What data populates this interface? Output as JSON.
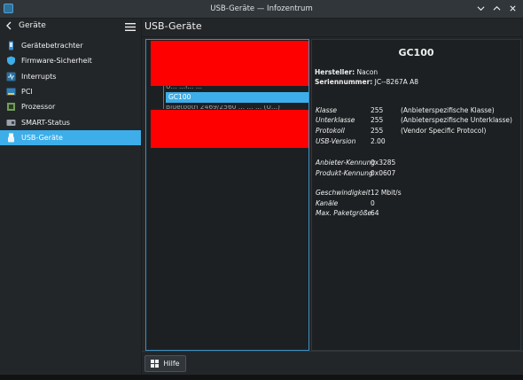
{
  "window": {
    "title": "USB-Geräte — Infozentrum",
    "icons": [
      "app-icon",
      "chevron-down-icon",
      "chevron-up-icon",
      "close-icon"
    ]
  },
  "sidebar": {
    "back_label": "Geräte",
    "items": [
      {
        "label": "Gerätebetrachter",
        "icon": "device-viewer-icon"
      },
      {
        "label": "Firmware-Sicherheit",
        "icon": "shield-icon"
      },
      {
        "label": "Interrupts",
        "icon": "interrupts-icon"
      },
      {
        "label": "PCI",
        "icon": "pci-icon"
      },
      {
        "label": "Prozessor",
        "icon": "processor-icon"
      },
      {
        "label": "SMART-Status",
        "icon": "smart-status-icon"
      },
      {
        "label": "USB-Geräte",
        "icon": "usb-icon",
        "active": true
      }
    ]
  },
  "main": {
    "title": "USB-Geräte",
    "tree": {
      "cut_label": "U...  ...l... ...",
      "selected": "GC100",
      "below_label": "Bluetooth 2469/2560 ... ... ... (U...)"
    },
    "detail": {
      "title": "GC100",
      "manufacturer_key": "Hersteller:",
      "manufacturer_value": "Nacon",
      "serial_key": "Seriennummer:",
      "serial_value": "JC--8267A A8",
      "rows_group1": [
        {
          "key": "Klasse",
          "value": "255",
          "desc": "(Anbieterspezifische Klasse)"
        },
        {
          "key": "Unterklasse",
          "value": "255",
          "desc": "(Anbieterspezifische Unterklasse)"
        },
        {
          "key": "Protokoll",
          "value": "255",
          "desc": "(Vendor Specific Protocol)"
        },
        {
          "key": "USB-Version",
          "value": "2.00",
          "desc": ""
        }
      ],
      "rows_group2": [
        {
          "key": "Anbieter-Kennung",
          "value": "0x3285"
        },
        {
          "key": "Produkt-Kennung",
          "value": "0x0607"
        }
      ],
      "rows_group3": [
        {
          "key": "Geschwindigkeit",
          "value": "12 Mbit/s"
        },
        {
          "key": "Kanäle",
          "value": "0"
        },
        {
          "key": "Max. Paketgröße",
          "value": "64"
        }
      ]
    }
  },
  "footer": {
    "help_label": "Hilfe",
    "help_icon": "help-icon"
  },
  "colors": {
    "accent": "#3daee9",
    "background": "#232629",
    "redaction": "#ff0000"
  }
}
